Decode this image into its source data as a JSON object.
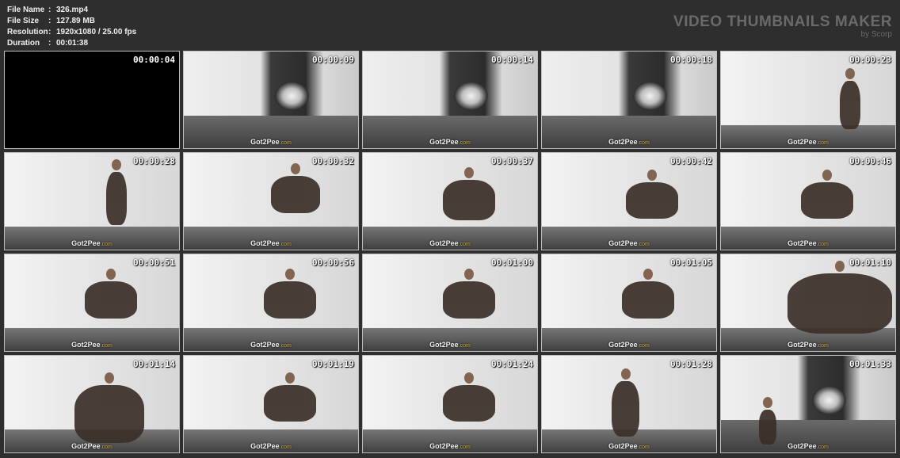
{
  "file_info": {
    "name_label": "File Name",
    "name_value": "326.mp4",
    "size_label": "File Size",
    "size_value": "127.89 MB",
    "resolution_label": "Resolution",
    "resolution_value": "1920x1080 / 25.00 fps",
    "duration_label": "Duration",
    "duration_value": "00:01:38",
    "separator": ":"
  },
  "brand": {
    "title": "VIDEO THUMBNAILS MAKER",
    "subtitle": "by Scorp"
  },
  "watermark": {
    "text": "Got2Pee",
    "suffix": ".com"
  },
  "thumbnails": [
    {
      "time": "00:00:04",
      "scene": "black"
    },
    {
      "time": "00:00:09",
      "scene": "tunnel"
    },
    {
      "time": "00:00:14",
      "scene": "tunnel"
    },
    {
      "time": "00:00:18",
      "scene": "tunnel"
    },
    {
      "time": "00:00:23",
      "scene": "wall"
    },
    {
      "time": "00:00:28",
      "scene": "wall"
    },
    {
      "time": "00:00:32",
      "scene": "wall"
    },
    {
      "time": "00:00:37",
      "scene": "wall"
    },
    {
      "time": "00:00:42",
      "scene": "wall"
    },
    {
      "time": "00:00:46",
      "scene": "wall"
    },
    {
      "time": "00:00:51",
      "scene": "wall"
    },
    {
      "time": "00:00:56",
      "scene": "wall"
    },
    {
      "time": "00:01:00",
      "scene": "wall"
    },
    {
      "time": "00:01:05",
      "scene": "wall"
    },
    {
      "time": "00:01:10",
      "scene": "wall"
    },
    {
      "time": "00:01:14",
      "scene": "wall"
    },
    {
      "time": "00:01:19",
      "scene": "wall"
    },
    {
      "time": "00:01:24",
      "scene": "wall"
    },
    {
      "time": "00:01:28",
      "scene": "wall"
    },
    {
      "time": "00:01:33",
      "scene": "tunnel"
    }
  ]
}
